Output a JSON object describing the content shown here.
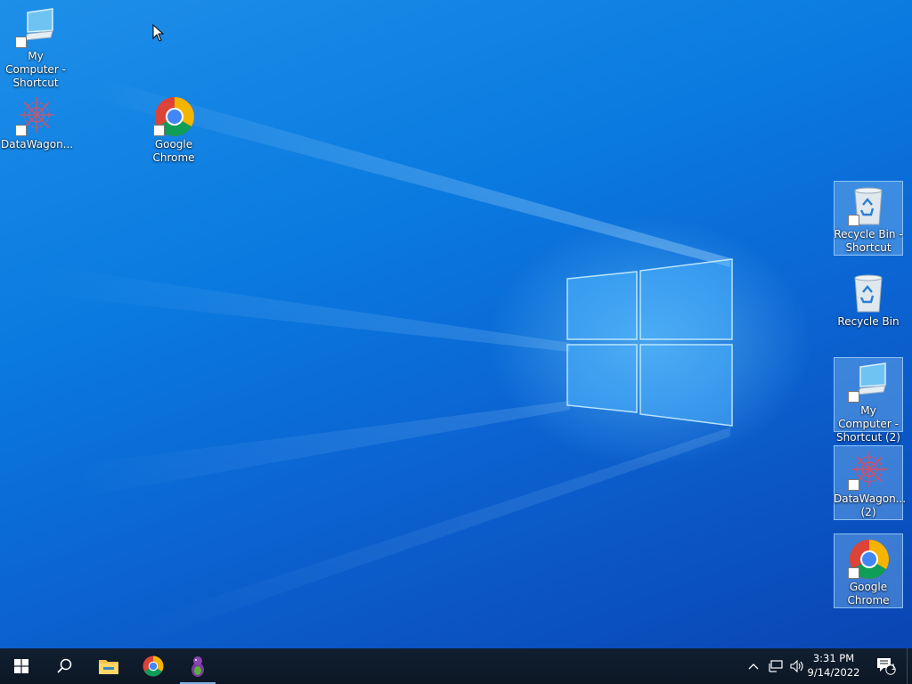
{
  "desktop": {
    "icons": [
      {
        "label": "My Computer - Shortcut",
        "icon": "computer-icon"
      },
      {
        "label": "DataWagon...",
        "icon": "datawagon-icon"
      },
      {
        "label": "Google Chrome",
        "icon": "chrome-icon"
      },
      {
        "label": "Recycle Bin - Shortcut",
        "icon": "recycle-bin-icon"
      },
      {
        "label": "Recycle Bin",
        "icon": "recycle-bin-icon"
      },
      {
        "label": "My Computer - Shortcut (2)",
        "icon": "computer-icon"
      },
      {
        "label": "DataWagon... (2)",
        "icon": "datawagon-icon"
      },
      {
        "label": "Google Chrome",
        "icon": "chrome-icon"
      }
    ]
  },
  "taskbar": {
    "buttons": [
      {
        "name": "start",
        "icon": "windows-start-icon"
      },
      {
        "name": "search",
        "icon": "search-icon"
      },
      {
        "name": "file-explorer",
        "icon": "folder-icon"
      },
      {
        "name": "chrome",
        "icon": "chrome-icon"
      },
      {
        "name": "app",
        "icon": "barney-app-icon",
        "active": true
      }
    ],
    "clock": {
      "time": "3:31 PM",
      "date": "9/14/2022"
    },
    "notifications": {
      "count": "1"
    }
  },
  "colors": {
    "accent": "#0a7ae0",
    "taskbar": "#0c1724"
  }
}
